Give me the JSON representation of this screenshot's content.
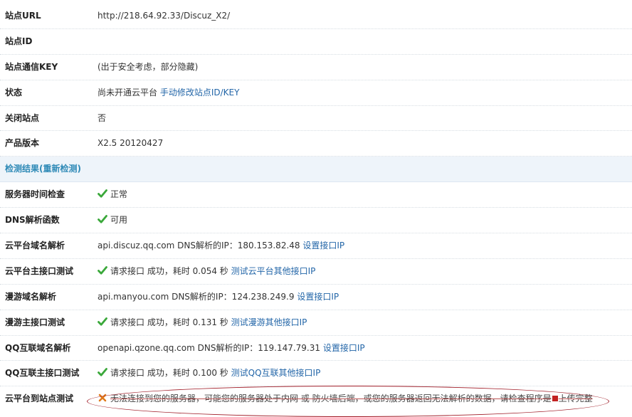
{
  "rows1": [
    {
      "label": "站点URL",
      "value": "http://218.64.92.33/Discuz_X2/"
    },
    {
      "label": "站点ID",
      "value": ""
    },
    {
      "label": "站点通信KEY",
      "value": "(出于安全考虑，部分隐藏)"
    },
    {
      "label": "状态",
      "value": "尚未开通云平台",
      "link": "手动修改站点ID/KEY"
    },
    {
      "label": "关闭站点",
      "value": "否"
    },
    {
      "label": "产品版本",
      "value": "X2.5 20120427"
    }
  ],
  "section": {
    "title": "检测结果",
    "paren_open": "(",
    "recheck": "重新检测",
    "paren_close": ")"
  },
  "check_rows": [
    {
      "label": "服务器时间检查",
      "status": "ok",
      "text": "正常"
    },
    {
      "label": "DNS解析函数",
      "status": "ok",
      "text": "可用"
    },
    {
      "label": "云平台域名解析",
      "text": "api.discuz.qq.com DNS解析的IP：180.153.82.48",
      "link": "设置接口IP"
    },
    {
      "label": "云平台主接口测试",
      "status": "ok",
      "text": "请求接口 成功，耗时 0.054 秒",
      "link": "测试云平台其他接口IP"
    },
    {
      "label": "漫游域名解析",
      "text": "api.manyou.com DNS解析的IP：124.238.249.9",
      "link": "设置接口IP"
    },
    {
      "label": "漫游主接口测试",
      "status": "ok",
      "text": "请求接口 成功，耗时 0.131 秒",
      "link": "测试漫游其他接口IP"
    },
    {
      "label": "QQ互联域名解析",
      "text": "openapi.qzone.qq.com DNS解析的IP：119.147.79.31",
      "link": "设置接口IP"
    },
    {
      "label": "QQ互联主接口测试",
      "status": "ok",
      "text": "请求接口 成功，耗时 0.100 秒",
      "link": "测试QQ互联其他接口IP"
    }
  ],
  "last_row": {
    "label": "云平台到站点测试",
    "status": "error",
    "text_before": "无法连接到您的服务器，可能您的服务器处于内网 或 防火墙后端，或您的服务器返回无法解析的数据，请检查程序是",
    "text_after": "上传完整"
  },
  "colors": {
    "link": "#2366a8",
    "section_bg": "#eef4fa",
    "section_title": "#2f8ab7",
    "ok": "#3aa83a",
    "error": "#e07a1a",
    "annotation": "#a11f2a"
  },
  "icons": {
    "ok": "check-icon",
    "error": "cross-icon"
  }
}
